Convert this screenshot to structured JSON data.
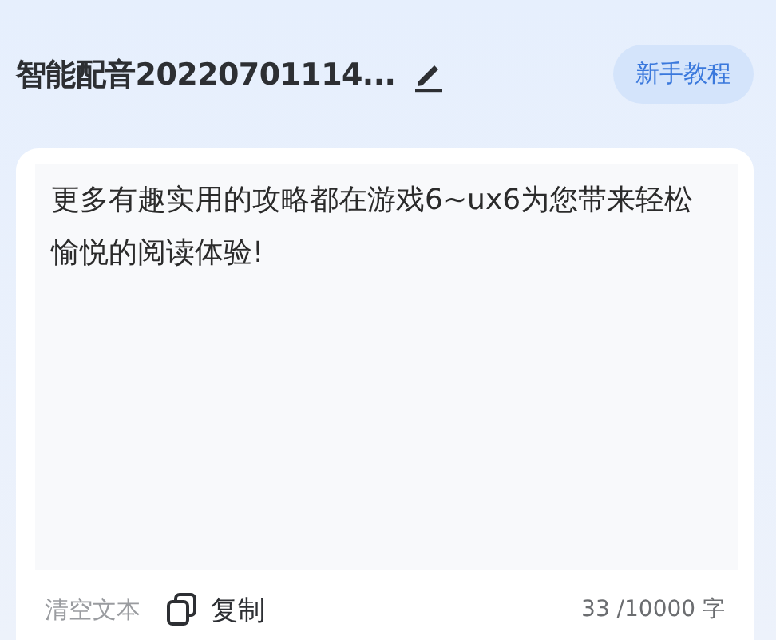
{
  "header": {
    "title": "智能配音20220701114...",
    "tutorial_button": "新手教程"
  },
  "editor": {
    "text": "更多有趣实用的攻略都在游戏6~ux6为您带来轻松愉悦的阅读体验!"
  },
  "footer": {
    "clear": "清空文本",
    "copy": "复制",
    "count": "33 /10000 字"
  }
}
